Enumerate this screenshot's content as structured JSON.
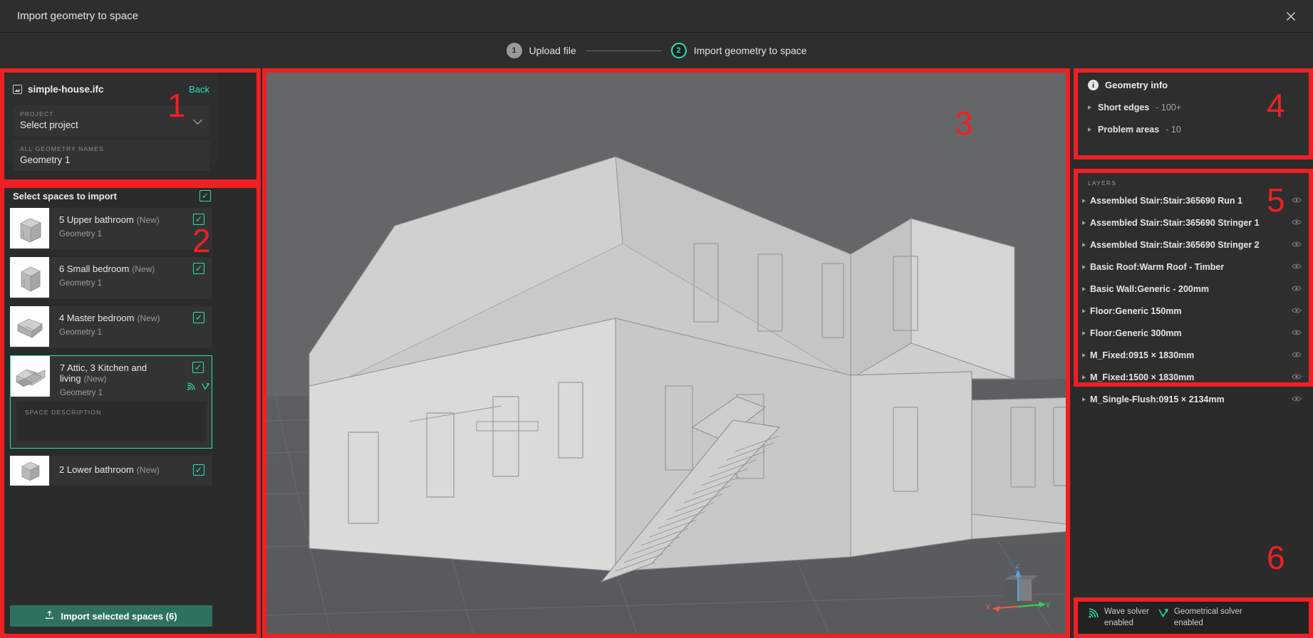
{
  "window": {
    "title": "Import geometry to space",
    "close_icon": "close-icon"
  },
  "stepper": {
    "steps": [
      {
        "num": "1",
        "label": "Upload file",
        "state": "done"
      },
      {
        "num": "2",
        "label": "Import geometry to space",
        "state": "active"
      }
    ]
  },
  "file_panel": {
    "annotation": "1",
    "file_icon": "image-file-icon",
    "file_name": "simple-house.ifc",
    "back_label": "Back",
    "project": {
      "label": "PROJECT",
      "value": "Select project",
      "chevron": "chevron-down-icon"
    },
    "geometry_names": {
      "label": "ALL GEOMETRY NAMES",
      "value": "Geometry 1"
    }
  },
  "spaces_panel": {
    "annotation": "2",
    "header": "Select spaces to import",
    "select_all_checked": "✓",
    "items": [
      {
        "title": "5 Upper bathroom",
        "badge": "(New)",
        "subtitle": "Geometry 1",
        "checked": "✓",
        "selected": false
      },
      {
        "title": "6 Small bedroom",
        "badge": "(New)",
        "subtitle": "Geometry 1",
        "checked": "✓",
        "selected": false
      },
      {
        "title": "4 Master bedroom",
        "badge": "(New)",
        "subtitle": "Geometry 1",
        "checked": "✓",
        "selected": false
      },
      {
        "title": "7 Attic, 3 Kitchen and living",
        "badge": "(New)",
        "subtitle": "Geometry 1",
        "checked": "✓",
        "selected": true,
        "description_label": "SPACE DESCRIPTION",
        "description_value": ""
      },
      {
        "title": "2 Lower bathroom",
        "badge": "(New)",
        "subtitle": "",
        "checked": "✓",
        "selected": false
      }
    ],
    "import_button": {
      "icon": "upload-icon",
      "label": "Import selected spaces (6)"
    }
  },
  "viewport": {
    "annotation": "3",
    "background_color": "#656668",
    "axis_gizmo": {
      "x": "X",
      "y": "Y",
      "z": "Z",
      "x_color": "#f4554a",
      "y_color": "#35d14a",
      "z_color": "#4aa8f0"
    }
  },
  "geometry_info": {
    "annotation": "4",
    "title": "Geometry info",
    "info_icon": "info-icon",
    "rows": [
      {
        "label": "Short edges",
        "count": "100+"
      },
      {
        "label": "Problem areas",
        "count": "10"
      }
    ]
  },
  "layers_panel": {
    "annotation": "5",
    "label": "LAYERS",
    "items": [
      "Assembled Stair:Stair:365690 Run 1",
      "Assembled Stair:Stair:365690 Stringer 1",
      "Assembled Stair:Stair:365690 Stringer 2",
      "Basic Roof:Warm Roof - Timber",
      "Basic Wall:Generic - 200mm",
      "Floor:Generic 150mm",
      "Floor:Generic 300mm",
      "M_Fixed:0915 × 1830mm",
      "M_Fixed:1500 × 1830mm",
      "M_Single-Flush:0915 × 2134mm"
    ]
  },
  "solvers_panel": {
    "annotation": "6",
    "items": [
      {
        "icon": "wave-solver-icon",
        "line1": "Wave solver",
        "line2": "enabled"
      },
      {
        "icon": "geometrical-solver-icon",
        "line1": "Geometrical solver",
        "line2": "enabled"
      }
    ]
  },
  "colors": {
    "accent": "#2fe0b0",
    "annotation_red": "#ee2024",
    "button_green": "#2f7161"
  }
}
